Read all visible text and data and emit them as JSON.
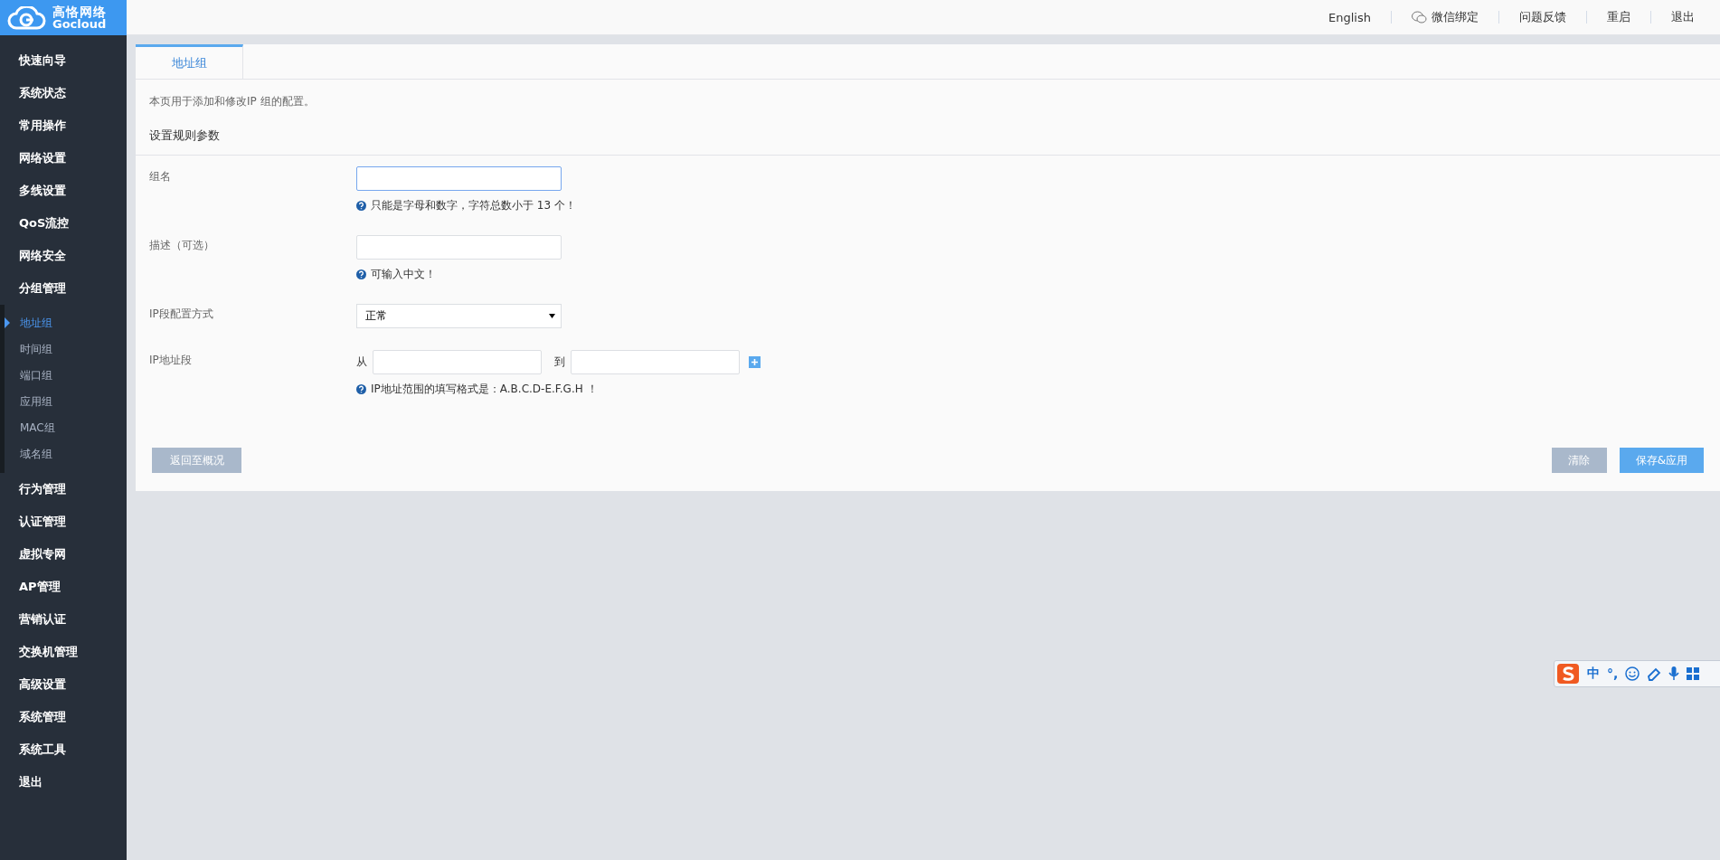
{
  "logo": {
    "name": "高恪网络",
    "sub": "Gocloud"
  },
  "header_links": [
    {
      "label": "English",
      "kind": "text"
    },
    {
      "label": "微信绑定",
      "kind": "wechat"
    },
    {
      "label": "问题反馈",
      "kind": "text"
    },
    {
      "label": "重启",
      "kind": "text"
    },
    {
      "label": "退出",
      "kind": "text"
    }
  ],
  "sidebar": {
    "items": [
      {
        "label": "快速向导"
      },
      {
        "label": "系统状态"
      },
      {
        "label": "常用操作"
      },
      {
        "label": "网络设置"
      },
      {
        "label": "多线设置"
      },
      {
        "label": "QoS流控"
      },
      {
        "label": "网络安全"
      },
      {
        "label": "分组管理",
        "children": [
          {
            "label": "地址组",
            "selected": true
          },
          {
            "label": "时间组",
            "selected": false
          },
          {
            "label": "端口组",
            "selected": false
          },
          {
            "label": "应用组",
            "selected": false
          },
          {
            "label": "MAC组",
            "selected": false
          },
          {
            "label": "域名组",
            "selected": false
          }
        ]
      },
      {
        "label": "行为管理"
      },
      {
        "label": "认证管理"
      },
      {
        "label": "虚拟专网"
      },
      {
        "label": "AP管理"
      },
      {
        "label": "营销认证"
      },
      {
        "label": "交换机管理"
      },
      {
        "label": "高级设置"
      },
      {
        "label": "系统管理"
      },
      {
        "label": "系统工具"
      },
      {
        "label": "退出"
      }
    ]
  },
  "tabs": [
    {
      "label": "地址组",
      "selected": true
    }
  ],
  "description": "本页用于添加和修改IP 组的配置。",
  "section_title": "设置规则参数",
  "fields": [
    {
      "kind": "text",
      "label": "组名",
      "focused": true,
      "hint": "只能是字母和数字，字符总数小于 13 个！"
    },
    {
      "kind": "text",
      "label": "描述（可选）",
      "focused": false,
      "hint": "可输入中文！"
    },
    {
      "kind": "select",
      "label": "IP段配置方式",
      "value": "正常"
    },
    {
      "kind": "range",
      "label": "IP地址段",
      "from_label": "从",
      "to_label": "到",
      "hint": "IP地址范围的填写格式是：A.B.C.D-E.F.G.H ！"
    }
  ],
  "buttons": [
    {
      "label": "返回至概况",
      "kind": "back"
    },
    {
      "label": "清除",
      "kind": "secondary"
    },
    {
      "label": "保存&应用",
      "kind": "primary"
    }
  ],
  "ime": {
    "mode": "中",
    "punct": "°,"
  }
}
